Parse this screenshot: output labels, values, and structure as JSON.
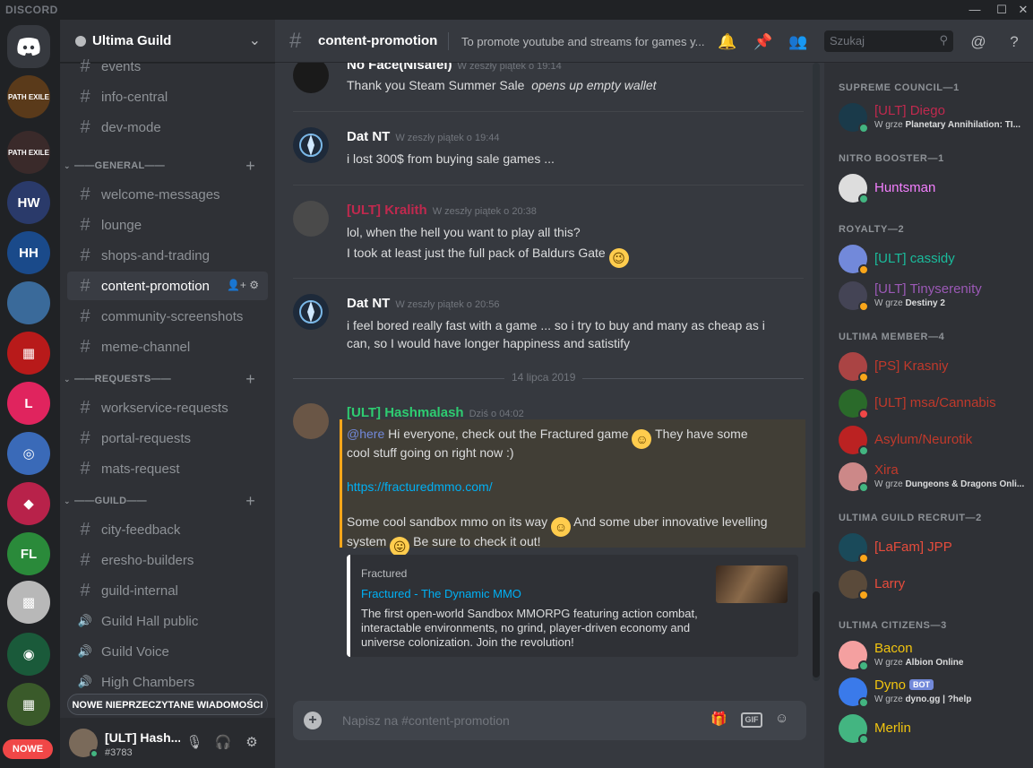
{
  "window": {
    "brand": "DISCORD",
    "minimize": "—",
    "maximize": "☐",
    "close": "✕"
  },
  "rail": {
    "servers": [
      {
        "label": "PATH EXILE",
        "color": "#5a3a1a"
      },
      {
        "label": "PATH EXILE",
        "color": "#3a2a2a"
      },
      {
        "label": "HW",
        "color": "#2a3a6a"
      },
      {
        "label": "HH",
        "color": "#1a4a8a"
      },
      {
        "label": "",
        "color": "#3a6a9a"
      },
      {
        "label": "▦",
        "color": "#b81a1a"
      },
      {
        "label": "L",
        "color": "#e0245e"
      },
      {
        "label": "◎",
        "color": "#3a6ab8"
      },
      {
        "label": "◆",
        "color": "#b8224a"
      },
      {
        "label": "FL",
        "color": "#2a8a3a"
      },
      {
        "label": "▩",
        "color": "#b8b8b8"
      },
      {
        "label": "◉",
        "color": "#1a5a3a"
      },
      {
        "label": "▦",
        "color": "#3a5a2a"
      }
    ],
    "new_badge": "NOWE"
  },
  "guild": {
    "name": "Ultima Guild"
  },
  "channels": {
    "top": [
      {
        "name": "events",
        "type": "text"
      },
      {
        "name": "info-central",
        "type": "text"
      },
      {
        "name": "dev-mode",
        "type": "text"
      }
    ],
    "categories": [
      {
        "name": "——GENERAL——",
        "channels": [
          {
            "name": "welcome-messages",
            "type": "text"
          },
          {
            "name": "lounge",
            "type": "text"
          },
          {
            "name": "shops-and-trading",
            "type": "text"
          },
          {
            "name": "content-promotion",
            "type": "text",
            "active": true
          },
          {
            "name": "community-screenshots",
            "type": "text"
          },
          {
            "name": "meme-channel",
            "type": "text"
          }
        ]
      },
      {
        "name": "——REQUESTS——",
        "channels": [
          {
            "name": "workservice-requests",
            "type": "text"
          },
          {
            "name": "portal-requests",
            "type": "text"
          },
          {
            "name": "mats-request",
            "type": "text"
          }
        ]
      },
      {
        "name": "——GUILD——",
        "channels": [
          {
            "name": "city-feedback",
            "type": "text"
          },
          {
            "name": "eresho-builders",
            "type": "text"
          },
          {
            "name": "guild-internal",
            "type": "text"
          },
          {
            "name": "Guild Hall public",
            "type": "voice"
          },
          {
            "name": "Guild Voice",
            "type": "voice"
          },
          {
            "name": "High Chambers",
            "type": "voice"
          }
        ]
      }
    ],
    "unread_bar": "NOWE NIEPRZECZYTANE WIADOMOŚCI"
  },
  "user": {
    "name": "[ULT] Hash...",
    "tag": "#3783"
  },
  "header": {
    "channel": "content-promotion",
    "topic": "To promote youtube and streams for games y...",
    "search_placeholder": "Szukaj"
  },
  "messages": [
    {
      "author": "No Face(Nisafel)",
      "author_color": "#ffffff",
      "time": "W zeszły piątek o 19:14",
      "lines": [
        "Thank you Steam Summer Sale",
        "opens up empty wallet"
      ]
    },
    {
      "author": "Dat NT",
      "author_color": "#ffffff",
      "time": "W zeszły piątek o 19:44",
      "lines": [
        "i lost 300$ from buying sale games ..."
      ]
    },
    {
      "author": "[ULT] Kralith",
      "author_color": "#c0294e",
      "time": "W zeszły piątek o 20:38",
      "lines": [
        "lol, when the hell you want to play all this?",
        "I took at least just the full pack of Baldurs Gate"
      ]
    },
    {
      "author": "Dat NT",
      "author_color": "#ffffff",
      "time": "W zeszły piątek o 20:56",
      "lines": [
        "i feel bored really fast with a game ... so i try to buy and many as cheap as i",
        "can, so I would have longer happiness and satistify"
      ]
    },
    {
      "author": "[ULT] Hashmalash",
      "author_color": "#2ecc71",
      "time": "Dziś o 04:02",
      "mention": "@here",
      "lines": [
        "Hi everyone, check out the Fractured game",
        "They have some",
        "cool stuff going on right now :)",
        "https://fracturedmmo.com/",
        "Some cool sandbox mmo on its way",
        "And some uber innovative levelling",
        "system",
        "Be sure to check it out!"
      ]
    }
  ],
  "date_divider": "14 lipca 2019",
  "embed": {
    "provider": "Fractured",
    "title": "Fractured - The Dynamic MMO",
    "description": "The first open-world Sandbox MMORPG featuring action combat, interactable environments, no grind, player-driven economy and universe colonization. Join the revolution!"
  },
  "composer": {
    "placeholder": "Napisz na #content-promotion",
    "gif": "GIF"
  },
  "members": {
    "groups": [
      {
        "role": "SUPREME COUNCIL—1",
        "members": [
          {
            "name": "[ULT] Diego",
            "color": "#c0294e",
            "status": "online",
            "activity_prefix": "W grze",
            "activity": "Planetary Annihilation: TI..."
          }
        ]
      },
      {
        "role": "NITRO BOOSTER—1",
        "members": [
          {
            "name": "Huntsman",
            "color": "#f47fff",
            "status": "online",
            "activity_prefix": "",
            "activity": ""
          }
        ]
      },
      {
        "role": "ROYALTY—2",
        "members": [
          {
            "name": "[ULT] cassidy",
            "color": "#1abc9c",
            "status": "idle",
            "activity_prefix": "",
            "activity": ""
          },
          {
            "name": "[ULT] Tinyserenity",
            "color": "#9b59b6",
            "status": "idle",
            "activity_prefix": "W grze",
            "activity": "Destiny 2"
          }
        ]
      },
      {
        "role": "ULTIMA MEMBER—4",
        "members": [
          {
            "name": "[PS] Krasniy",
            "color": "#c0392b",
            "status": "idle",
            "activity_prefix": "",
            "activity": ""
          },
          {
            "name": "[ULT] msa/Cannabis",
            "color": "#c0392b",
            "status": "dnd",
            "activity_prefix": "",
            "activity": ""
          },
          {
            "name": "Asylum/Neurotik",
            "color": "#c0392b",
            "status": "online",
            "activity_prefix": "",
            "activity": ""
          },
          {
            "name": "Xira",
            "color": "#c0392b",
            "status": "online",
            "activity_prefix": "W grze",
            "activity": "Dungeons & Dragons Onli..."
          }
        ]
      },
      {
        "role": "ULTIMA GUILD RECRUIT—2",
        "members": [
          {
            "name": "[LaFam] JPP",
            "color": "#e74c3c",
            "status": "idle",
            "activity_prefix": "",
            "activity": ""
          },
          {
            "name": "Larry",
            "color": "#e74c3c",
            "status": "idle",
            "activity_prefix": "",
            "activity": ""
          }
        ]
      },
      {
        "role": "ULTIMA CITIZENS—3",
        "members": [
          {
            "name": "Bacon",
            "color": "#f1c40f",
            "status": "online",
            "activity_prefix": "W grze",
            "activity": "Albion Online"
          },
          {
            "name": "Dyno",
            "color": "#f1c40f",
            "status": "online",
            "bot": "BOT",
            "activity_prefix": "W grze",
            "activity": "dyno.gg | ?help"
          },
          {
            "name": "Merlin",
            "color": "#f1c40f",
            "status": "online",
            "activity_prefix": "",
            "activity": ""
          }
        ]
      }
    ]
  },
  "colors": {
    "online": "#43b581",
    "idle": "#faa61a",
    "dnd": "#f04747",
    "link": "#00b0f4",
    "mention": "#7289da"
  }
}
